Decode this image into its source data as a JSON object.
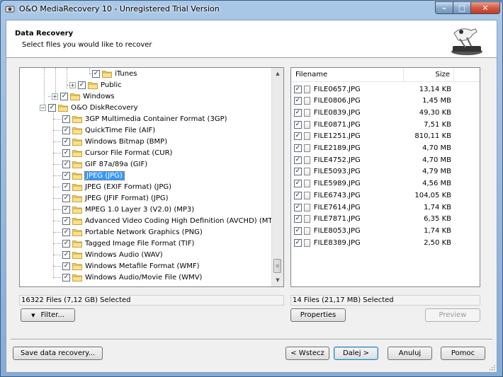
{
  "window": {
    "title": "O&O MediaRecovery 10 - Unregistered Trial Version",
    "controls": {
      "minimize": "–",
      "maximize": "□",
      "close": "✕"
    }
  },
  "header": {
    "title": "Data Recovery",
    "subtitle": "Select files you would like to recover"
  },
  "tree": {
    "items": [
      {
        "label": "iTunes",
        "checked": true
      },
      {
        "label": "Public",
        "checked": true,
        "expander": "+"
      },
      {
        "label": "Windows",
        "checked": true,
        "expander": "+"
      },
      {
        "label": "O&O DiskRecovery",
        "checked": true,
        "expander": "−"
      },
      {
        "label": "3GP Multimedia Container Format (3GP)",
        "checked": true
      },
      {
        "label": "QuickTime File (AIF)",
        "checked": true
      },
      {
        "label": "Windows Bitmap (BMP)",
        "checked": true
      },
      {
        "label": "Cursor File Format (CUR)",
        "checked": true
      },
      {
        "label": "GIF 87a/89a (GIF)",
        "checked": true
      },
      {
        "label": "JPEG (JPG)",
        "checked": true,
        "selected": true
      },
      {
        "label": "JPEG (EXIF Format) (JPG)",
        "checked": true
      },
      {
        "label": "JPEG (JFIF Format) (JPG)",
        "checked": true
      },
      {
        "label": "MPEG 1.0 Layer 3 (V2.0) (MP3)",
        "checked": true
      },
      {
        "label": "Advanced Video Coding High Definition (AVCHD) (MTS)",
        "checked": true
      },
      {
        "label": "Portable Network Graphics (PNG)",
        "checked": true
      },
      {
        "label": "Tagged Image File Format (TIF)",
        "checked": true
      },
      {
        "label": "Windows Audio (WAV)",
        "checked": true
      },
      {
        "label": "Windows Metafile Format (WMF)",
        "checked": true
      },
      {
        "label": "Windows Audio/Movie File (WMV)",
        "checked": true
      }
    ],
    "scroll": {
      "up": "▲",
      "down": "▼",
      "grip": "≡"
    }
  },
  "files": {
    "headers": {
      "name": "Filename",
      "size": "Size"
    },
    "rows": [
      {
        "name": "FILE0657.JPG",
        "size": "13,14 KB"
      },
      {
        "name": "FILE0806.JPG",
        "size": "1,45 MB"
      },
      {
        "name": "FILE0839.JPG",
        "size": "49,30 KB"
      },
      {
        "name": "FILE0871.JPG",
        "size": "7,51 KB"
      },
      {
        "name": "FILE1251.JPG",
        "size": "810,11 KB"
      },
      {
        "name": "FILE2189.JPG",
        "size": "4,70 MB"
      },
      {
        "name": "FILE4752.JPG",
        "size": "4,70 MB"
      },
      {
        "name": "FILE5093.JPG",
        "size": "4,79 MB"
      },
      {
        "name": "FILE5989.JPG",
        "size": "4,56 MB"
      },
      {
        "name": "FILE6743.JPG",
        "size": "104,05 KB"
      },
      {
        "name": "FILE7614.JPG",
        "size": "1,74 KB"
      },
      {
        "name": "FILE7871.JPG",
        "size": "6,35 KB"
      },
      {
        "name": "FILE8053.JPG",
        "size": "1,74 KB"
      },
      {
        "name": "FILE8389.JPG",
        "size": "2,50 KB"
      }
    ]
  },
  "status": {
    "left": "16322 Files (7,12 GB) Selected",
    "right": "14 Files (21,17 MB) Selected"
  },
  "buttons": {
    "filter": "Filter...",
    "filter_arrow": "▼",
    "properties": "Properties",
    "preview": "Preview",
    "save": "Save data recovery...",
    "back": "< Wstecz",
    "next": "Dalej >",
    "cancel": "Anuluj",
    "help": "Pomoc"
  },
  "check_mark": "✓"
}
